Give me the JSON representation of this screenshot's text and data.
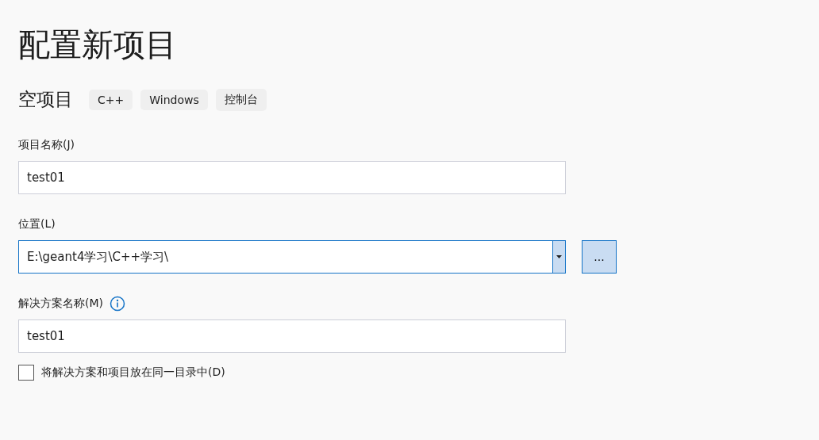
{
  "title": "配置新项目",
  "template": {
    "name": "空项目",
    "tags": [
      "C++",
      "Windows",
      "控制台"
    ]
  },
  "fields": [
    {
      "kind": "text",
      "label": "项目名称(J)",
      "value": "test01",
      "info": false,
      "focused": false
    },
    {
      "kind": "combo",
      "label": "位置(L)",
      "value": "E:\\geant4学习\\C++学习\\",
      "browse_label": "...",
      "info": false,
      "focused": true
    },
    {
      "kind": "text",
      "label": "解决方案名称(M)",
      "value": "test01",
      "info": true,
      "focused": false
    }
  ],
  "same_dir": {
    "label": "将解决方案和项目放在同一目录中(D)",
    "checked": false
  }
}
